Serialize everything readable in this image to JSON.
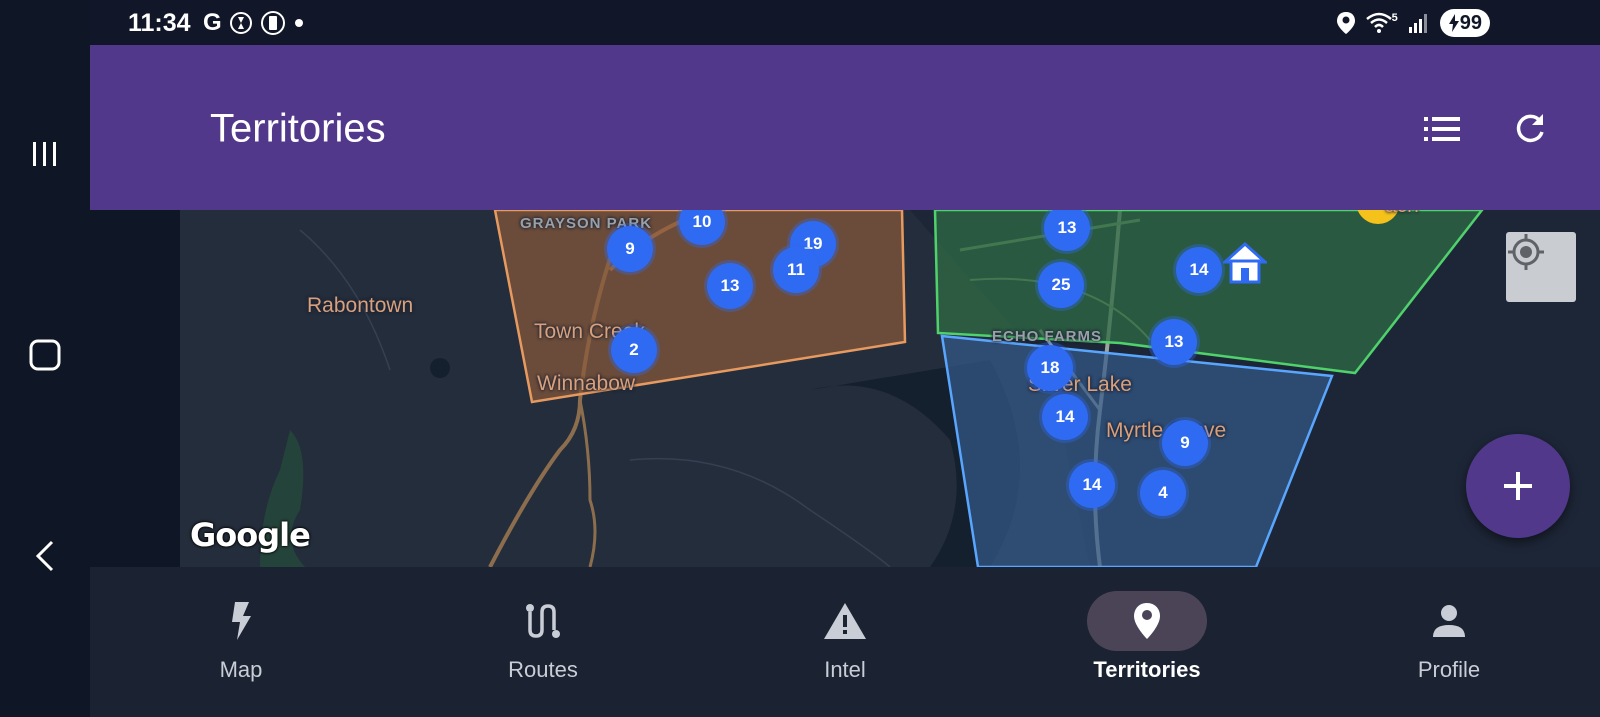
{
  "status_bar": {
    "time": "11:34",
    "google_glyph": "G",
    "battery": "99",
    "signal_label": "5"
  },
  "app_bar": {
    "title": "Territories"
  },
  "map": {
    "places": [
      {
        "name": "Rabontown"
      },
      {
        "name": "Town Creek"
      },
      {
        "name": "Winnabow"
      },
      {
        "name": "Silver Lake"
      },
      {
        "name": "Myrtle Grove"
      }
    ],
    "areas": [
      {
        "name": "GRAYSON PARK"
      },
      {
        "name": "ECHO FARMS"
      }
    ],
    "partial_label": "ach",
    "clusters": [
      {
        "count": "10"
      },
      {
        "count": "9"
      },
      {
        "count": "19"
      },
      {
        "count": "11"
      },
      {
        "count": "13"
      },
      {
        "count": "2"
      },
      {
        "count": "13"
      },
      {
        "count": "25"
      },
      {
        "count": "14"
      },
      {
        "count": "13"
      },
      {
        "count": "18"
      },
      {
        "count": "14"
      },
      {
        "count": "9"
      },
      {
        "count": "14"
      },
      {
        "count": "4"
      }
    ],
    "attribution": "Google",
    "territory_colors": {
      "orange": "#8a5a3c",
      "green": "#2f6b45",
      "blue": "#355a8a"
    }
  },
  "bottom_nav": {
    "items": [
      {
        "label": "Map",
        "icon": "bolt-icon"
      },
      {
        "label": "Routes",
        "icon": "route-icon"
      },
      {
        "label": "Intel",
        "icon": "warning-icon"
      },
      {
        "label": "Territories",
        "icon": "location-pin-icon",
        "active": true
      },
      {
        "label": "Profile",
        "icon": "person-icon"
      }
    ]
  },
  "colors": {
    "app_bar": "#51388b",
    "cluster": "#2f6bf2",
    "background": "#111729"
  }
}
